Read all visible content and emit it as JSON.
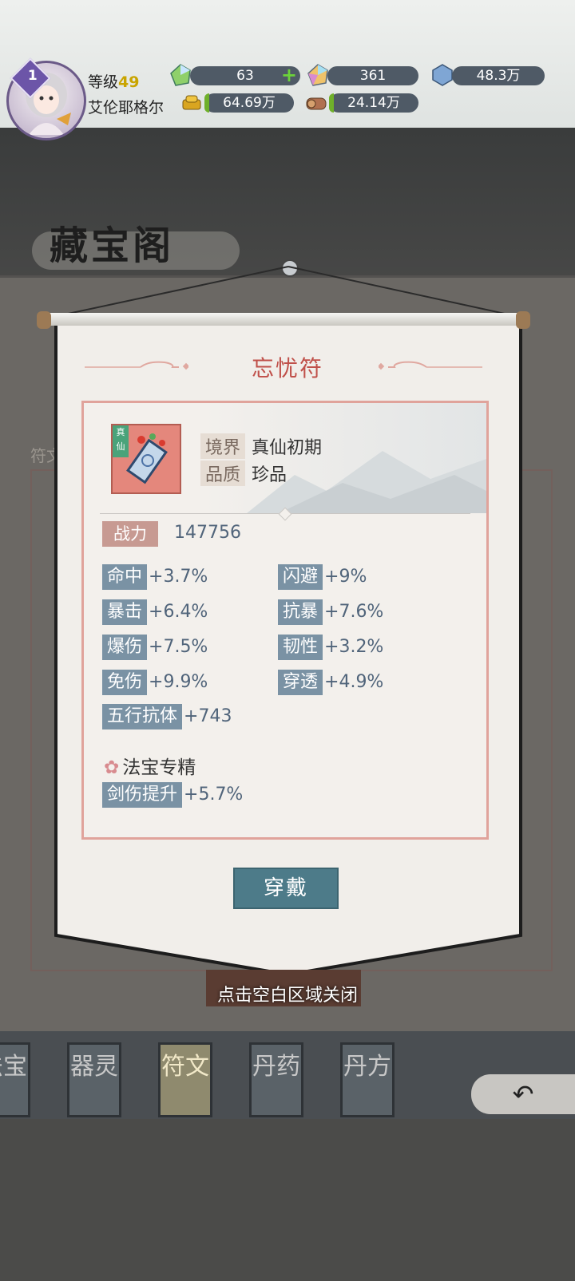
{
  "header": {
    "level_label": "等级",
    "level_value": "49",
    "vip_level": "1",
    "player_name": "艾伦耶格尔",
    "resources": {
      "crystal": "63",
      "rainbow_gem": "361",
      "blue_crystal": "48.3万",
      "gold": "64.69万",
      "wood": "24.14万"
    }
  },
  "page": {
    "title": "藏宝阁",
    "side_label": "符文"
  },
  "modal": {
    "title": "忘忧符",
    "item_tag": "真仙",
    "info": [
      {
        "key": "境界",
        "value": "真仙初期"
      },
      {
        "key": "品质",
        "value": "珍品"
      }
    ],
    "power_label": "战力",
    "power_value": "147756",
    "stats": [
      {
        "key": "命中",
        "value": "+3.7%"
      },
      {
        "key": "闪避",
        "value": "+9%"
      },
      {
        "key": "暴击",
        "value": "+6.4%"
      },
      {
        "key": "抗暴",
        "value": "+7.6%"
      },
      {
        "key": "爆伤",
        "value": "+7.5%"
      },
      {
        "key": "韧性",
        "value": "+3.2%"
      },
      {
        "key": "免伤",
        "value": "+9.9%"
      },
      {
        "key": "穿透",
        "value": "+4.9%"
      },
      {
        "key": "五行抗体",
        "value": "+743"
      }
    ],
    "spec_title": "法宝专精",
    "spec_stats": [
      {
        "key": "剑伤提升",
        "value": "+5.7%"
      }
    ],
    "equip_button": "穿戴",
    "close_hint": "点击空白区域关闭"
  },
  "tabs": [
    {
      "label": "法宝"
    },
    {
      "label": "器灵"
    },
    {
      "label": "符文"
    },
    {
      "label": "丹药"
    },
    {
      "label": "丹方"
    }
  ],
  "back_button": "↶",
  "icons": [
    "crystal-icon",
    "rainbow-gem-icon",
    "blue-crystal-icon",
    "gold-icon",
    "wood-icon",
    "back-arrow-icon"
  ]
}
